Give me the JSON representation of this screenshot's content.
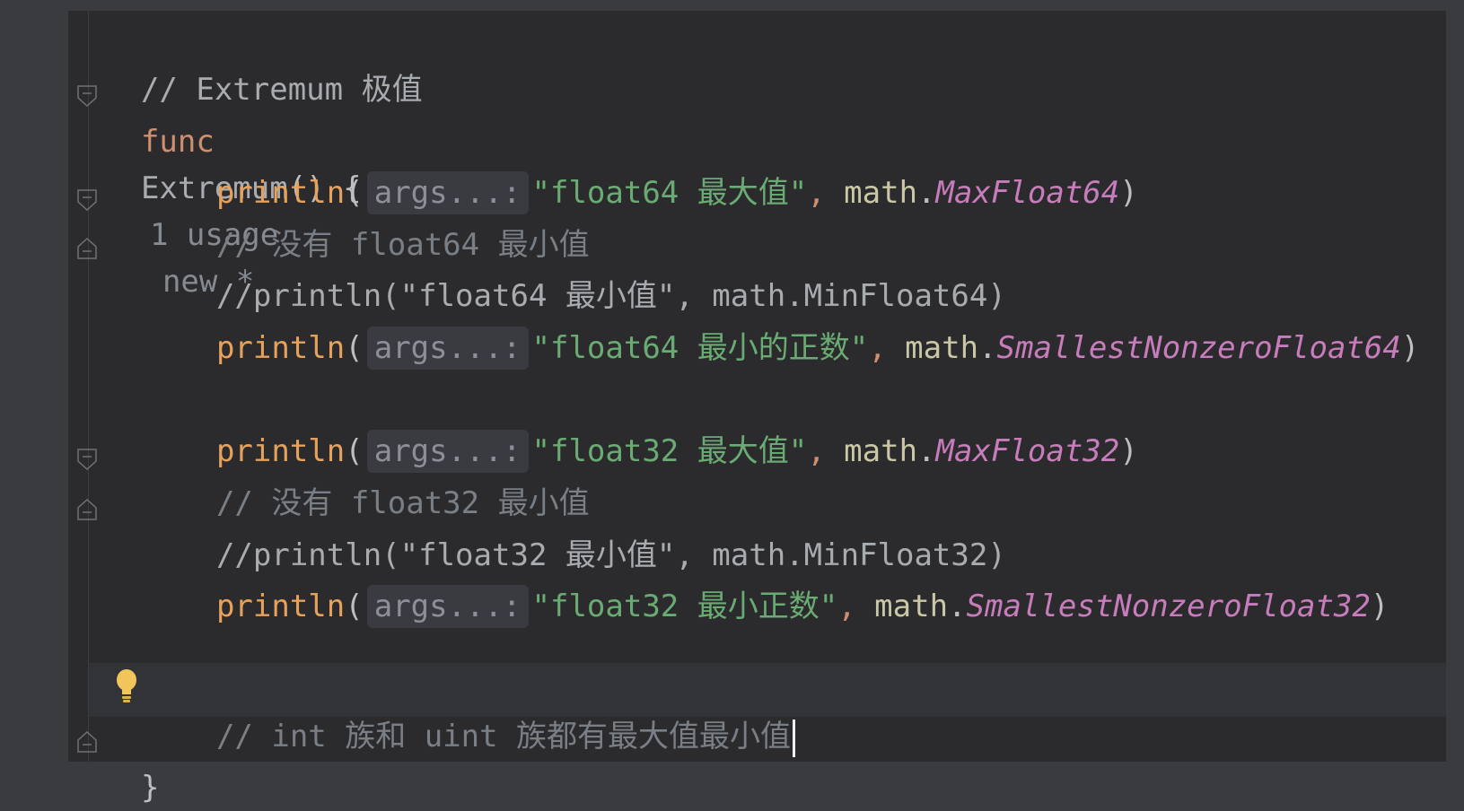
{
  "code": {
    "line1": "// Extremum 极值",
    "line2_kw": "func",
    "line2_name": "Extremum",
    "line2_rest": "() {",
    "line2_usage": "1 usage",
    "line2_new": "new *",
    "hint_label": "args...:",
    "println_kw": "println",
    "open_paren": "(",
    "close_paren": ")",
    "comma": ", ",
    "pkg_math": "math",
    "dot": ".",
    "l3_str": "\"float64 最大值\"",
    "l3_const": "MaxFloat64",
    "l4": "// 没有 float64 最小值",
    "l5": "//println(\"float64 最小值\", math.MinFloat64)",
    "l6_str": "\"float64 最小的正数\"",
    "l6_const": "SmallestNonzeroFloat64",
    "l8_str": "\"float32 最大值\"",
    "l8_const": "MaxFloat32",
    "l9": "// 没有 float32 最小值",
    "l10": "//println(\"float32 最小值\", math.MinFloat32)",
    "l11_str": "\"float32 最小正数\"",
    "l11_const": "SmallestNonzeroFloat32",
    "l13": "// int 族和 uint 族都有最大值最小值",
    "l14": "}"
  },
  "icons": {
    "fold": "fold-marker-icon",
    "bulb": "lightbulb-icon"
  },
  "colors": {
    "keyword": "#cf8e6d",
    "string": "#6aab73",
    "constant": "#c77dbb",
    "comment": "#7a7e85",
    "background": "#2b2b2d"
  }
}
